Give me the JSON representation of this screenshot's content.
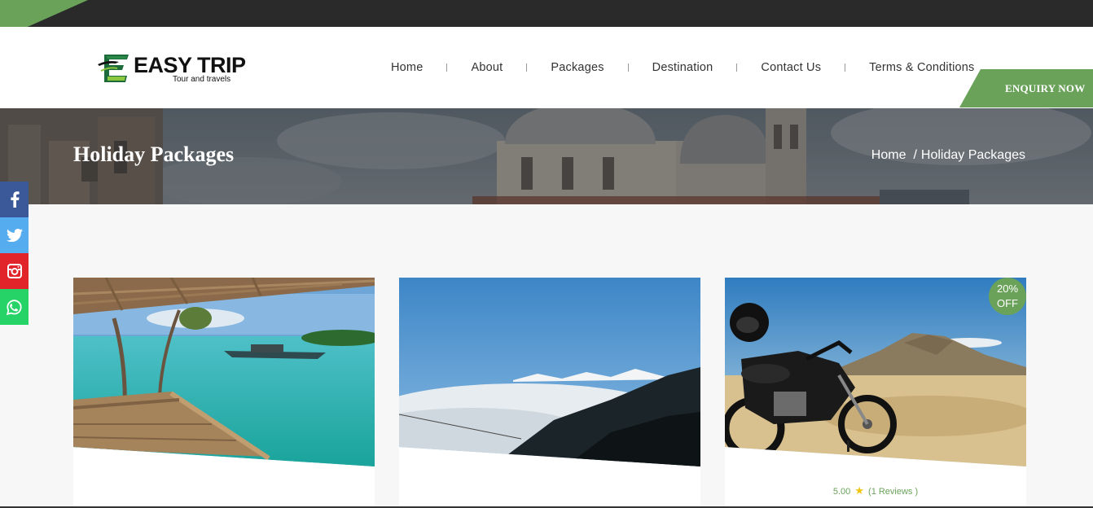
{
  "brand": {
    "name": "EASY TRIP",
    "tagline": "Tour and travels",
    "logo_icon": "e-logo-icon"
  },
  "nav": {
    "items": [
      {
        "label": "Home"
      },
      {
        "label": "About"
      },
      {
        "label": "Packages"
      },
      {
        "label": "Destination"
      },
      {
        "label": "Contact Us"
      },
      {
        "label": "Terms & Conditions"
      }
    ],
    "enquiry_label": "ENQUIRY NOW"
  },
  "banner": {
    "title": "Holiday Packages",
    "breadcrumb": {
      "home": "Home",
      "separator": "/",
      "current": "Holiday Packages"
    }
  },
  "social": [
    {
      "icon": "facebook-icon",
      "color": "#3b5998"
    },
    {
      "icon": "twitter-icon",
      "color": "#55acee"
    },
    {
      "icon": "instagram-icon",
      "color": "#e1232a"
    },
    {
      "icon": "whatsapp-icon",
      "color": "#25d366"
    }
  ],
  "cards": [
    {
      "image": "tropical-beach-photo"
    },
    {
      "image": "mountain-clouds-photo"
    },
    {
      "image": "motorcycle-desert-photo",
      "discount": {
        "value": "20%",
        "label": "OFF"
      },
      "rating": {
        "score": "5.00",
        "reviews": "(1 Reviews )"
      }
    }
  ],
  "colors": {
    "accent": "#6aa25a",
    "topbar": "#2a2a2a",
    "star": "#f1c40f"
  }
}
